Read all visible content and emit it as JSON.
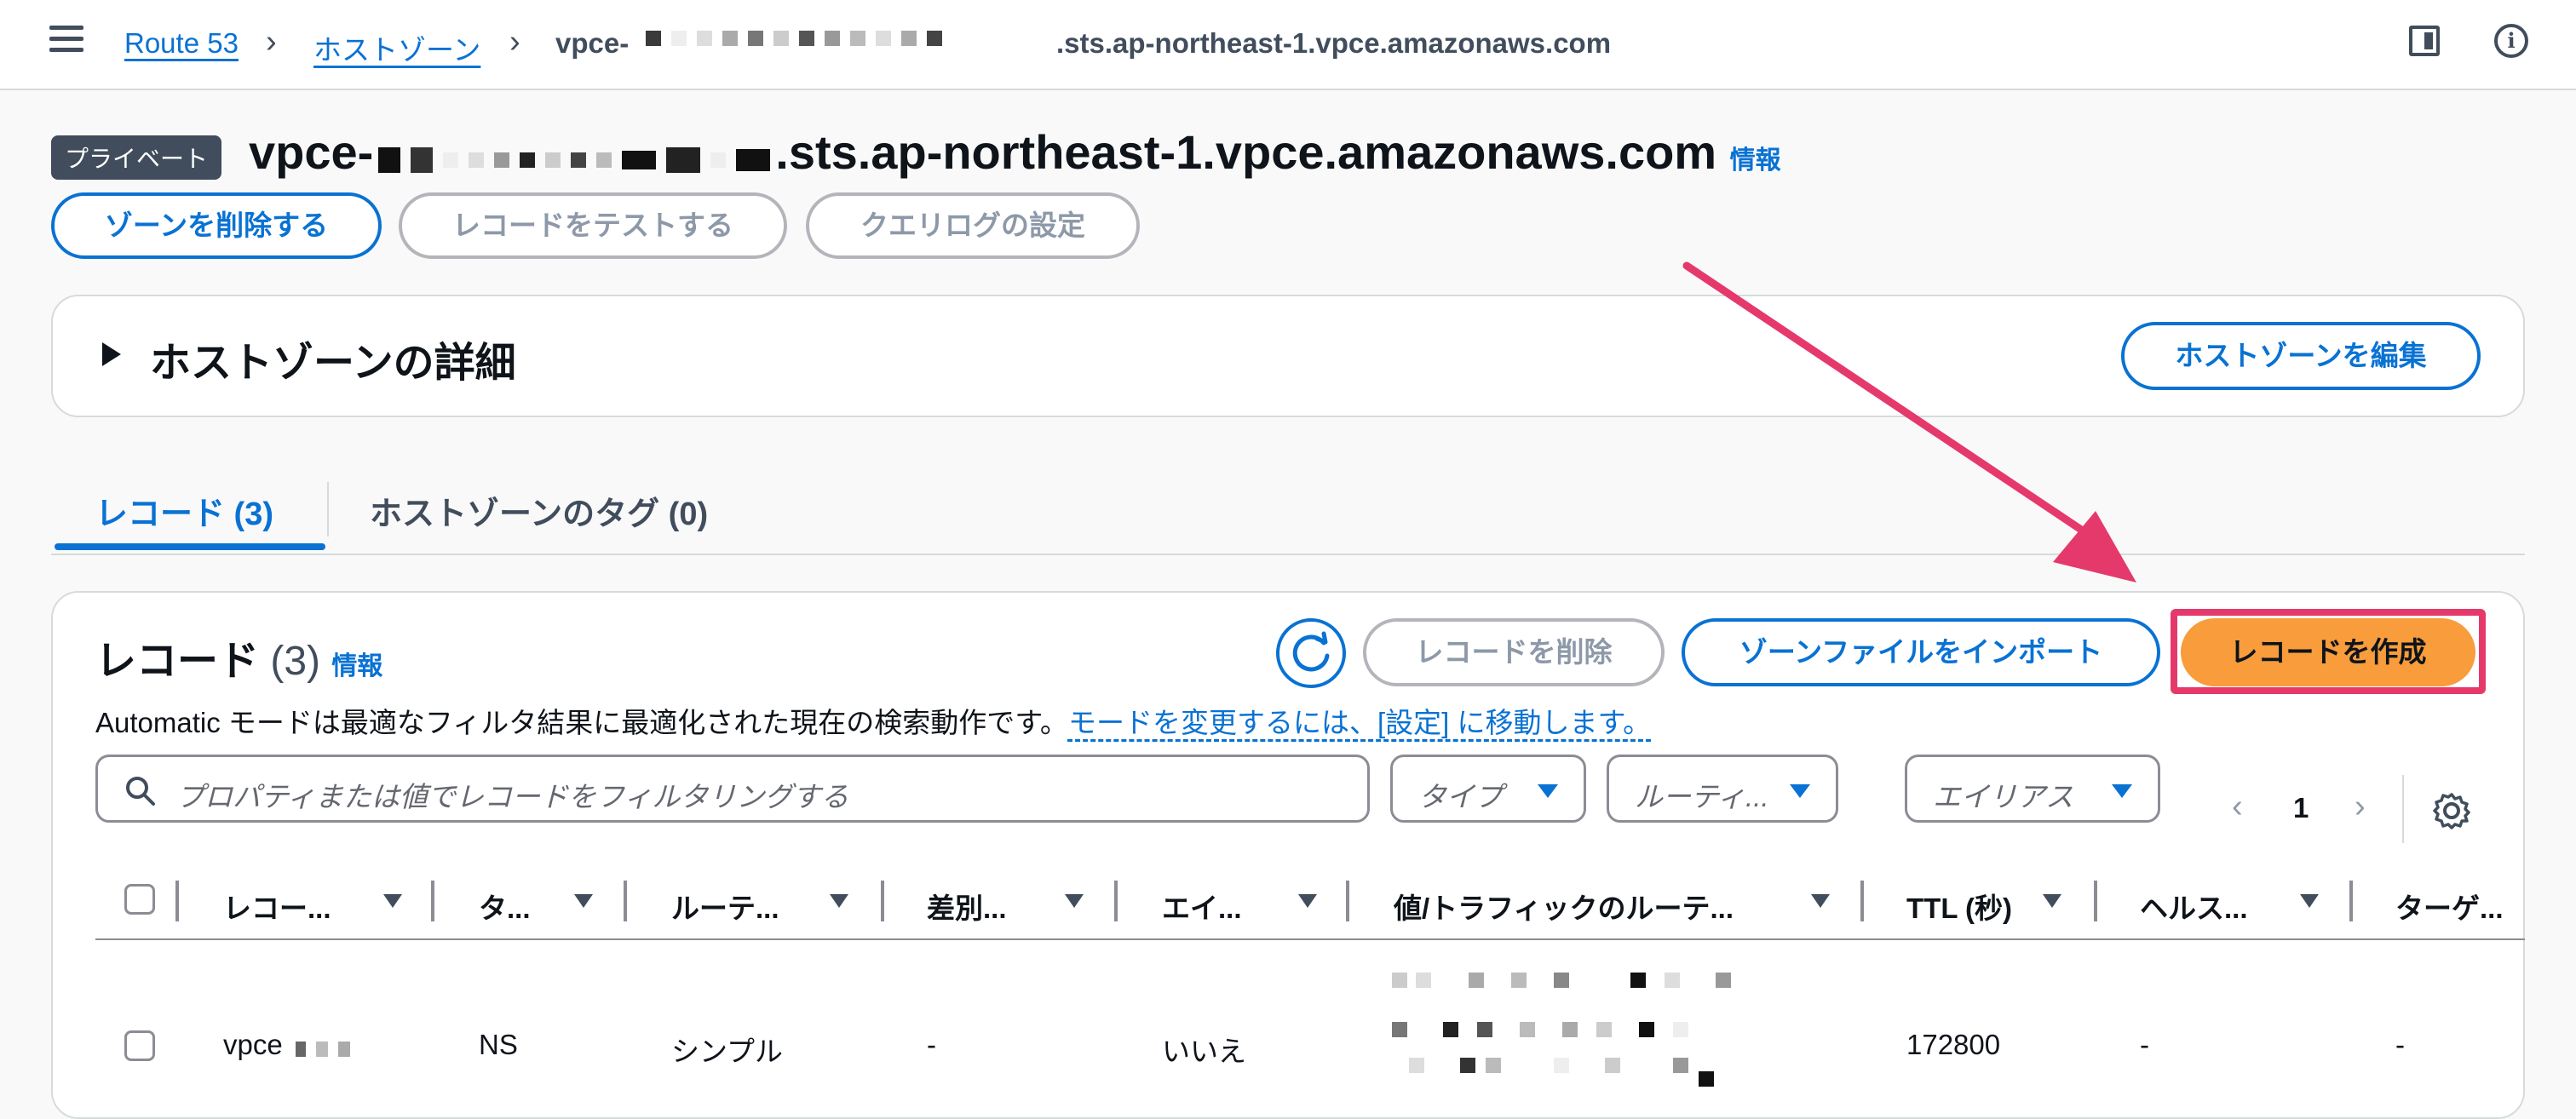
{
  "breadcrumb": {
    "items": [
      "Route 53",
      "ホストゾーン"
    ],
    "current_prefix": "vpce-",
    "current_suffix": ".sts.ap-northeast-1.vpce.amazonaws.com"
  },
  "header": {
    "badge": "プライベート",
    "title_prefix": "vpce-",
    "title_suffix": ".sts.ap-northeast-1.vpce.amazonaws.com",
    "info": "情報"
  },
  "actions": {
    "delete_zone": "ゾーンを削除する",
    "test_record": "レコードをテストする",
    "query_log": "クエリログの設定"
  },
  "details": {
    "title": "ホストゾーンの詳細",
    "edit_button": "ホストゾーンを編集"
  },
  "tabs": [
    {
      "label": "レコード (3)"
    },
    {
      "label": "ホストゾーンのタグ (0)"
    }
  ],
  "records": {
    "title": "レコード",
    "count": "(3)",
    "info": "情報",
    "delete_button": "レコードを削除",
    "import_button": "ゾーンファイルをインポート",
    "create_button": "レコードを作成",
    "description": "Automatic モードは最適なフィルタ結果に最適化された現在の検索動作です。",
    "description_link": "モードを変更するには、[設定] に移動します。",
    "search_placeholder": "プロパティまたは値でレコードをフィルタリングする",
    "filters": [
      "タイプ",
      "ルーティ...",
      "エイリアス"
    ],
    "page": "1",
    "columns": [
      "レコー...",
      "タ...",
      "ルーテ...",
      "差別...",
      "エイ...",
      "値/トラフィックのルーテ...",
      "TTL (秒)",
      "ヘルス...",
      "ターゲ..."
    ],
    "rows": [
      {
        "name": "vpce",
        "type": "NS",
        "routing": "シンプル",
        "diff": "-",
        "alias": "いいえ",
        "ttl": "172800",
        "health": "-",
        "target": "-"
      }
    ]
  },
  "colors": {
    "link": "#0972d3",
    "primary_button": "#f89c3c",
    "highlight": "#e5396b",
    "badge": "#414d5c"
  },
  "icons": [
    "menu-icon",
    "panel-icon",
    "info-icon",
    "refresh-icon",
    "search-icon",
    "chevron-left-icon",
    "chevron-right-icon",
    "gear-icon",
    "caret-down-icon",
    "sort-icon"
  ]
}
